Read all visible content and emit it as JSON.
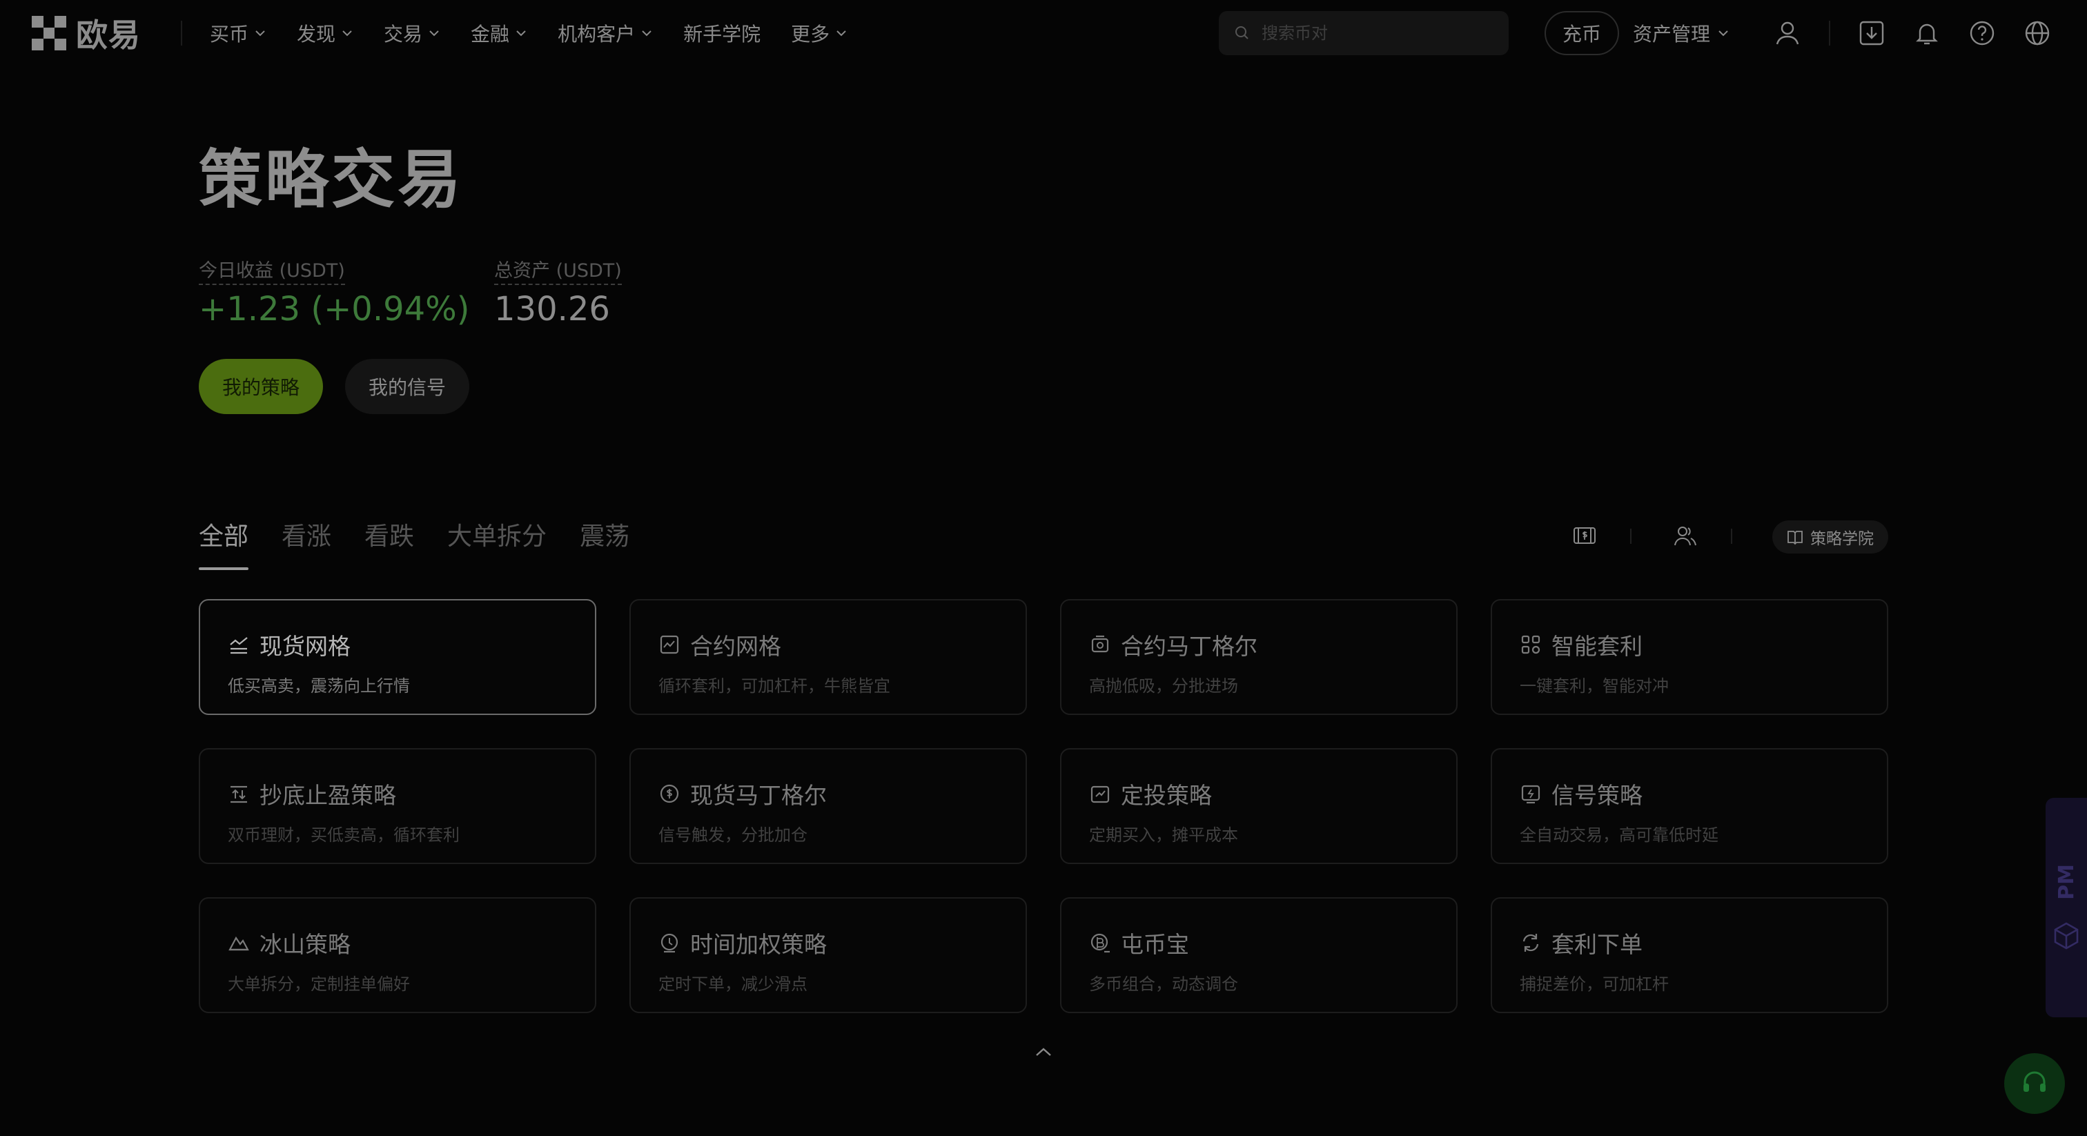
{
  "brand": {
    "name": "欧易"
  },
  "nav": {
    "items": [
      {
        "label": "买币",
        "has_dropdown": true
      },
      {
        "label": "发现",
        "has_dropdown": true
      },
      {
        "label": "交易",
        "has_dropdown": true
      },
      {
        "label": "金融",
        "has_dropdown": true
      },
      {
        "label": "机构客户",
        "has_dropdown": true
      },
      {
        "label": "新手学院",
        "has_dropdown": false
      },
      {
        "label": "更多",
        "has_dropdown": true
      }
    ],
    "search_placeholder": "搜索币对",
    "deposit_label": "充币",
    "asset_mgmt_label": "资产管理"
  },
  "header_icons": [
    "user-icon",
    "download-icon",
    "bell-icon",
    "help-icon",
    "globe-icon"
  ],
  "page": {
    "title": "策略交易",
    "today_pnl_label": "今日收益 (USDT)",
    "today_pnl_value": "+1.23 (+0.94%)",
    "total_assets_label": "总资产 (USDT)",
    "total_assets_value": "130.26",
    "my_strategy_label": "我的策略",
    "my_signal_label": "我的信号"
  },
  "tabs": [
    {
      "label": "全部",
      "active": true
    },
    {
      "label": "看涨",
      "active": false
    },
    {
      "label": "看跌",
      "active": false
    },
    {
      "label": "大单拆分",
      "active": false
    },
    {
      "label": "震荡",
      "active": false
    }
  ],
  "toolbar": {
    "academy_label": "策略学院"
  },
  "cards": [
    {
      "title": "现货网格",
      "desc": "低买高卖，震荡向上行情",
      "icon": "grid-chart-icon",
      "selected": true
    },
    {
      "title": "合约网格",
      "desc": "循环套利，可加杠杆，牛熊皆宜",
      "icon": "futures-grid-icon",
      "selected": false
    },
    {
      "title": "合约马丁格尔",
      "desc": "高抛低吸，分批进场",
      "icon": "futures-martingale-icon",
      "selected": false
    },
    {
      "title": "智能套利",
      "desc": "一键套利，智能对冲",
      "icon": "arbitrage-icon",
      "selected": false
    },
    {
      "title": "抄底止盈策略",
      "desc": "双币理财，买低卖高，循环套利",
      "icon": "buy-dip-icon",
      "selected": false
    },
    {
      "title": "现货马丁格尔",
      "desc": "信号触发，分批加仓",
      "icon": "spot-martingale-icon",
      "selected": false
    },
    {
      "title": "定投策略",
      "desc": "定期买入，摊平成本",
      "icon": "dca-icon",
      "selected": false
    },
    {
      "title": "信号策略",
      "desc": "全自动交易，高可靠低时延",
      "icon": "signal-icon",
      "selected": false
    },
    {
      "title": "冰山策略",
      "desc": "大单拆分，定制挂单偏好",
      "icon": "iceberg-icon",
      "selected": false
    },
    {
      "title": "时间加权策略",
      "desc": "定时下单，减少滑点",
      "icon": "twap-icon",
      "selected": false
    },
    {
      "title": "屯币宝",
      "desc": "多币组合，动态调仓",
      "icon": "coin-hoard-icon",
      "selected": false
    },
    {
      "title": "套利下单",
      "desc": "捕捉差价，可加杠杆",
      "icon": "arbitrage-order-icon",
      "selected": false
    }
  ],
  "side_tab": {
    "label": "PM"
  },
  "colors": {
    "background": "#050505",
    "accent_green": "#4b6d0f",
    "pnl_green": "#3d7a3a",
    "side_tab_bg": "#130f26",
    "support_bg": "#0b3012"
  }
}
